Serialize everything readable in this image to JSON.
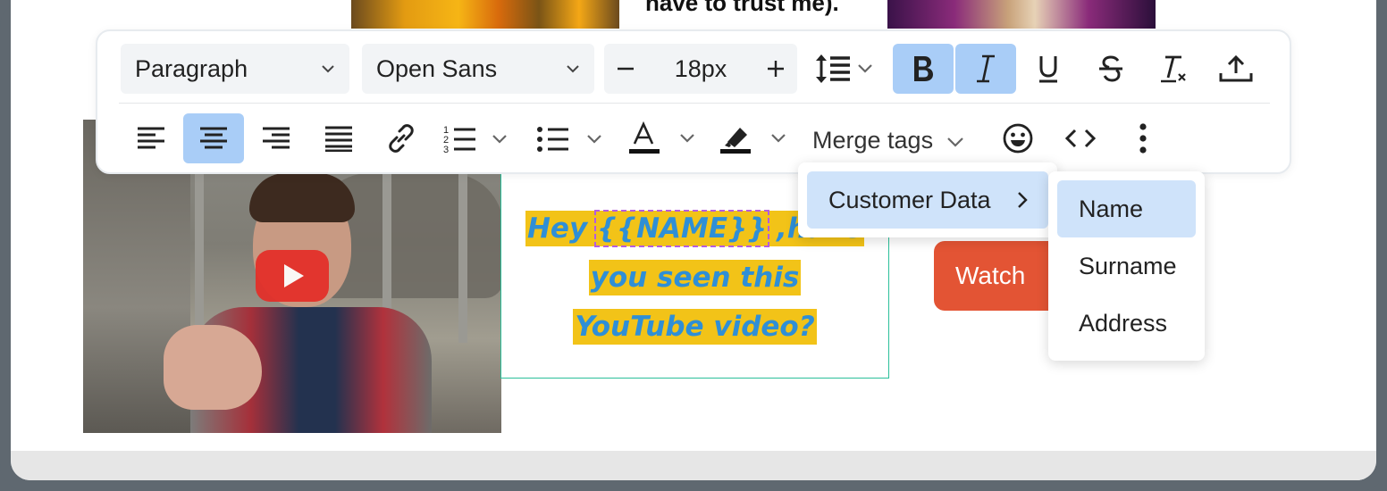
{
  "top_fragment": {
    "text": "have to trust me)."
  },
  "toolbar": {
    "block_format": "Paragraph",
    "font_family": "Open Sans",
    "font_size": "18px",
    "merge_tags_label": "Merge tags",
    "active_color": "#a9cdf7"
  },
  "content": {
    "line1_prefix": "Hey ",
    "merge_tag": "{{NAME}}",
    "line1_suffix": " ,have",
    "line2": "you seen this",
    "line3": "YouTube video?",
    "highlight_color": "#f2c318",
    "text_color": "#2f8fd6",
    "watch_button": "Watch"
  },
  "merge_menu": {
    "group": "Customer Data",
    "items": [
      "Name",
      "Surname",
      "Address"
    ],
    "selected": "Name"
  }
}
